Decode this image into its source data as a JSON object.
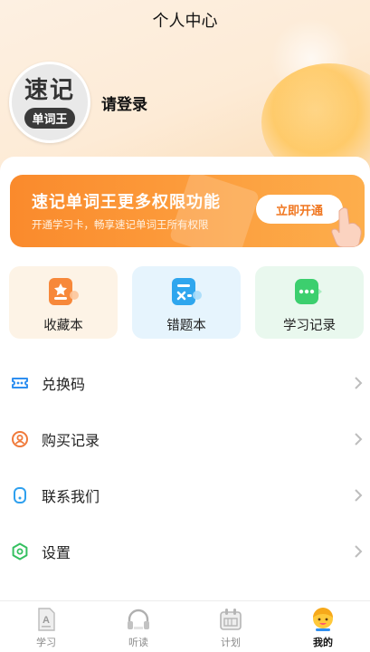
{
  "header": {
    "title": "个人中心"
  },
  "profile": {
    "avatar_main": "速记",
    "avatar_tag": "单词王",
    "login_text": "请登录"
  },
  "vip": {
    "title": "速记单词王更多权限功能",
    "subtitle": "开通学习卡，畅享速记单词王所有权限",
    "button": "立即开通",
    "accent": "#fa8a2c"
  },
  "quick": [
    {
      "label": "收藏本",
      "icon": "star-book-icon",
      "color": "#f7883a"
    },
    {
      "label": "错题本",
      "icon": "error-book-icon",
      "color": "#2fa6ee"
    },
    {
      "label": "学习记录",
      "icon": "chat-record-icon",
      "color": "#3ccf6e"
    }
  ],
  "menu": [
    {
      "label": "兑换码",
      "icon": "ticket-icon",
      "color": "#2f8ff0"
    },
    {
      "label": "购买记录",
      "icon": "user-circle-icon",
      "color": "#f07a3a"
    },
    {
      "label": "联系我们",
      "icon": "contact-icon",
      "color": "#2fa0ee"
    },
    {
      "label": "设置",
      "icon": "hexagon-settings-icon",
      "color": "#35c060"
    }
  ],
  "tabs": [
    {
      "label": "学习",
      "icon": "document-icon",
      "active": false
    },
    {
      "label": "听读",
      "icon": "headphones-icon",
      "active": false
    },
    {
      "label": "计划",
      "icon": "calendar-icon",
      "active": false
    },
    {
      "label": "我的",
      "icon": "profile-avatar-icon",
      "active": true
    }
  ]
}
